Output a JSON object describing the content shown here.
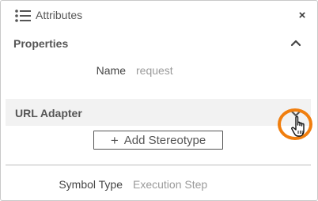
{
  "panel": {
    "title": "Attributes",
    "close_label": "×"
  },
  "properties": {
    "header_label": "Properties",
    "expanded": true,
    "fields": [
      {
        "name": "Name",
        "value": "request"
      }
    ]
  },
  "url_adapter": {
    "header_label": "URL Adapter",
    "expanded": false
  },
  "stereotype": {
    "add_label": "Add Stereotype",
    "plus_glyph": "+"
  },
  "symbol": {
    "name": "Symbol Type",
    "value": "Execution Step"
  },
  "colors": {
    "highlight_ring": "#f07e0e",
    "section_background": "#f2f2f2"
  },
  "icons": {
    "panel_icon": "list-icon",
    "close": "close-icon",
    "properties_toggle": "chevron-up-icon",
    "url_adapter_toggle": "chevron-down-icon",
    "pointer": "hand-cursor-icon"
  }
}
